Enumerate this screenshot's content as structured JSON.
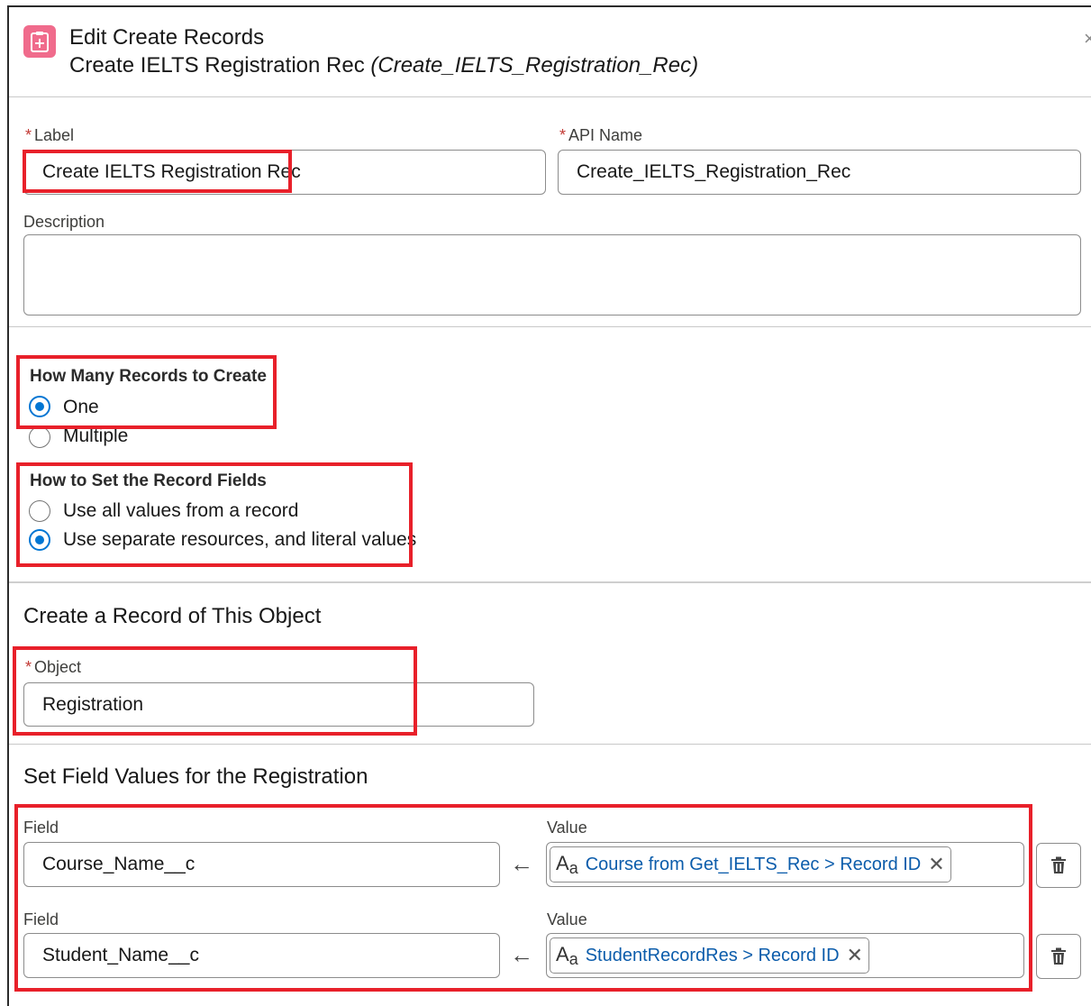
{
  "header": {
    "title": "Edit Create Records",
    "subtitle_label": "Create IELTS Registration Rec",
    "subtitle_api": "(Create_IELTS_Registration_Rec)",
    "icon": "create-record-icon",
    "close_icon": "close-icon"
  },
  "fields": {
    "required_marker": "*",
    "label_label": "Label",
    "label_value": "Create IELTS Registration Rec",
    "api_label": "API Name",
    "api_value": "Create_IELTS_Registration_Rec",
    "description_label": "Description",
    "description_value": ""
  },
  "how_many": {
    "title": "How Many Records to Create",
    "options": [
      {
        "label": "One",
        "selected": true
      },
      {
        "label": "Multiple",
        "selected": false
      }
    ]
  },
  "how_to_set": {
    "title": "How to Set the Record Fields",
    "options": [
      {
        "label": "Use all values from a record",
        "selected": false
      },
      {
        "label": "Use separate resources, and literal values",
        "selected": true
      }
    ]
  },
  "object_section": {
    "title": "Create a Record of This Object",
    "object_label": "Object",
    "object_value": "Registration"
  },
  "field_values": {
    "title": "Set Field Values for the Registration",
    "field_label": "Field",
    "value_label": "Value",
    "rows": [
      {
        "field": "Course_Name__c",
        "value": "Course from Get_IELTS_Rec > Record ID"
      },
      {
        "field": "Student_Name__c",
        "value": "StudentRecordRes > Record ID"
      }
    ]
  },
  "colors": {
    "accent": "#0176d3",
    "highlight_box": "#e8202a",
    "header_icon": "#f06b8c",
    "pill_text": "#0b5cab"
  }
}
